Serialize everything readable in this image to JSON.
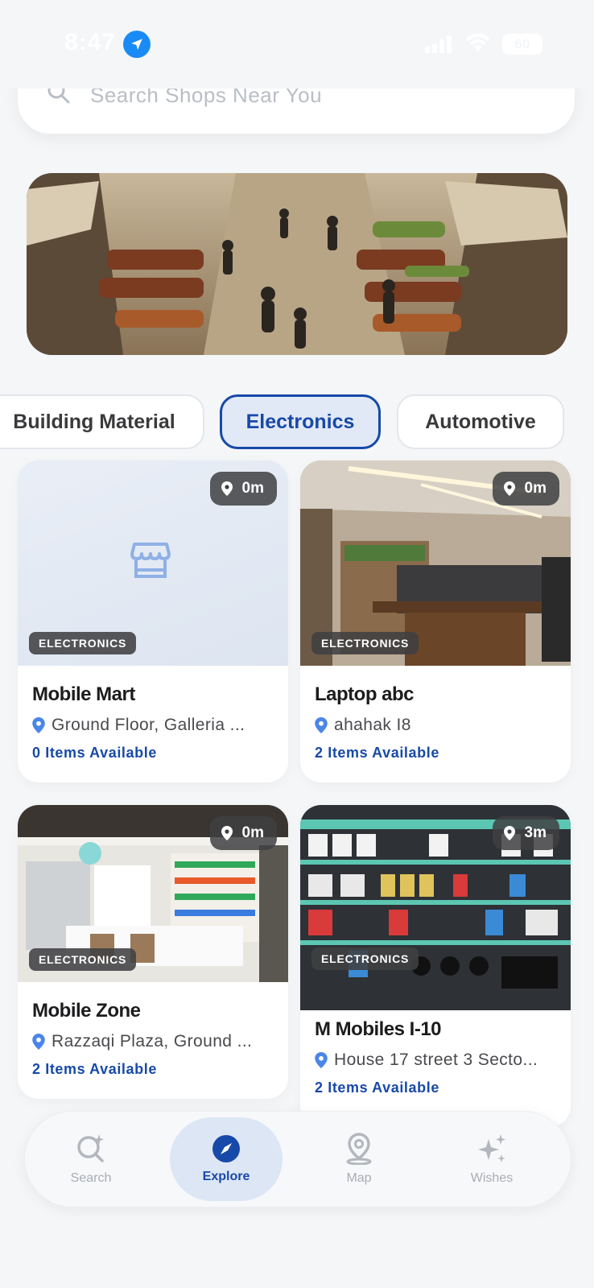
{
  "status_bar": {
    "time": "8:47",
    "battery": "60"
  },
  "search": {
    "placeholder": "Search Shops Near You"
  },
  "categories": [
    {
      "label": "Building Material",
      "active": false
    },
    {
      "label": "Electronics",
      "active": true
    },
    {
      "label": "Automotive",
      "active": false
    }
  ],
  "shops": [
    {
      "name": "Mobile Mart",
      "category": "ELECTRONICS",
      "distance": "0m",
      "address": "Ground Floor, Galleria ...",
      "items": "0 Items Available"
    },
    {
      "name": "Laptop abc",
      "category": "ELECTRONICS",
      "distance": "0m",
      "address": "ahahak I8",
      "items": "2 Items Available"
    },
    {
      "name": "Mobile Zone",
      "category": "ELECTRONICS",
      "distance": "0m",
      "address": "Razzaqi Plaza, Ground ...",
      "items": "2 Items Available"
    },
    {
      "name": "M Mobiles I-10",
      "category": "ELECTRONICS",
      "distance": "3m",
      "address": "House 17 street 3 Secto...",
      "items": "2 Items Available"
    }
  ],
  "nav": [
    {
      "label": "Search",
      "icon": "search-sparkle-icon",
      "active": false
    },
    {
      "label": "Explore",
      "icon": "compass-icon",
      "active": true
    },
    {
      "label": "Map",
      "icon": "map-pin-icon",
      "active": false
    },
    {
      "label": "Wishes",
      "icon": "sparkles-icon",
      "active": false
    }
  ],
  "colors": {
    "accent": "#1749a8",
    "background": "#f4f6f8",
    "card": "#ffffff"
  }
}
